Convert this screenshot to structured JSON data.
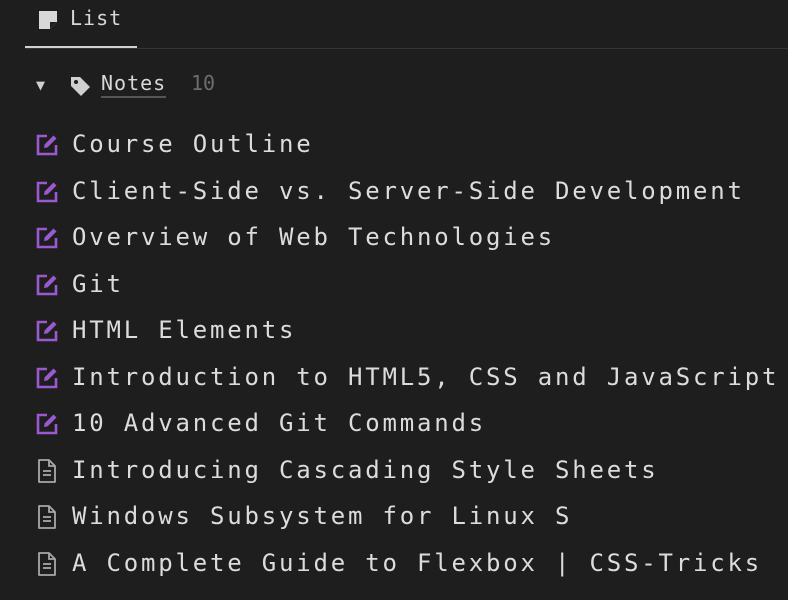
{
  "tab": {
    "label": "List",
    "icon": "note-icon"
  },
  "group": {
    "icon": "tag-icon",
    "title": "Notes",
    "count": "10",
    "expanded": true
  },
  "items": [
    {
      "label": "Course Outline",
      "type": "edit"
    },
    {
      "label": "Client-Side vs. Server-Side Development",
      "type": "edit"
    },
    {
      "label": "Overview of Web Technologies",
      "type": "edit"
    },
    {
      "label": "Git",
      "type": "edit"
    },
    {
      "label": "HTML Elements",
      "type": "edit"
    },
    {
      "label": "Introduction to HTML5, CSS and JavaScript",
      "type": "edit"
    },
    {
      "label": "10 Advanced Git Commands",
      "type": "edit"
    },
    {
      "label": "Introducing Cascading Style Sheets",
      "type": "document"
    },
    {
      "label": "Windows Subsystem for Linux S",
      "type": "document"
    },
    {
      "label": "A Complete Guide to Flexbox | CSS-Tricks",
      "type": "document"
    }
  ],
  "colors": {
    "background": "#1e1e1e",
    "edit_icon": "#9b59d0",
    "document_icon": "#a8a8a8",
    "count": "#6c6c6c"
  }
}
